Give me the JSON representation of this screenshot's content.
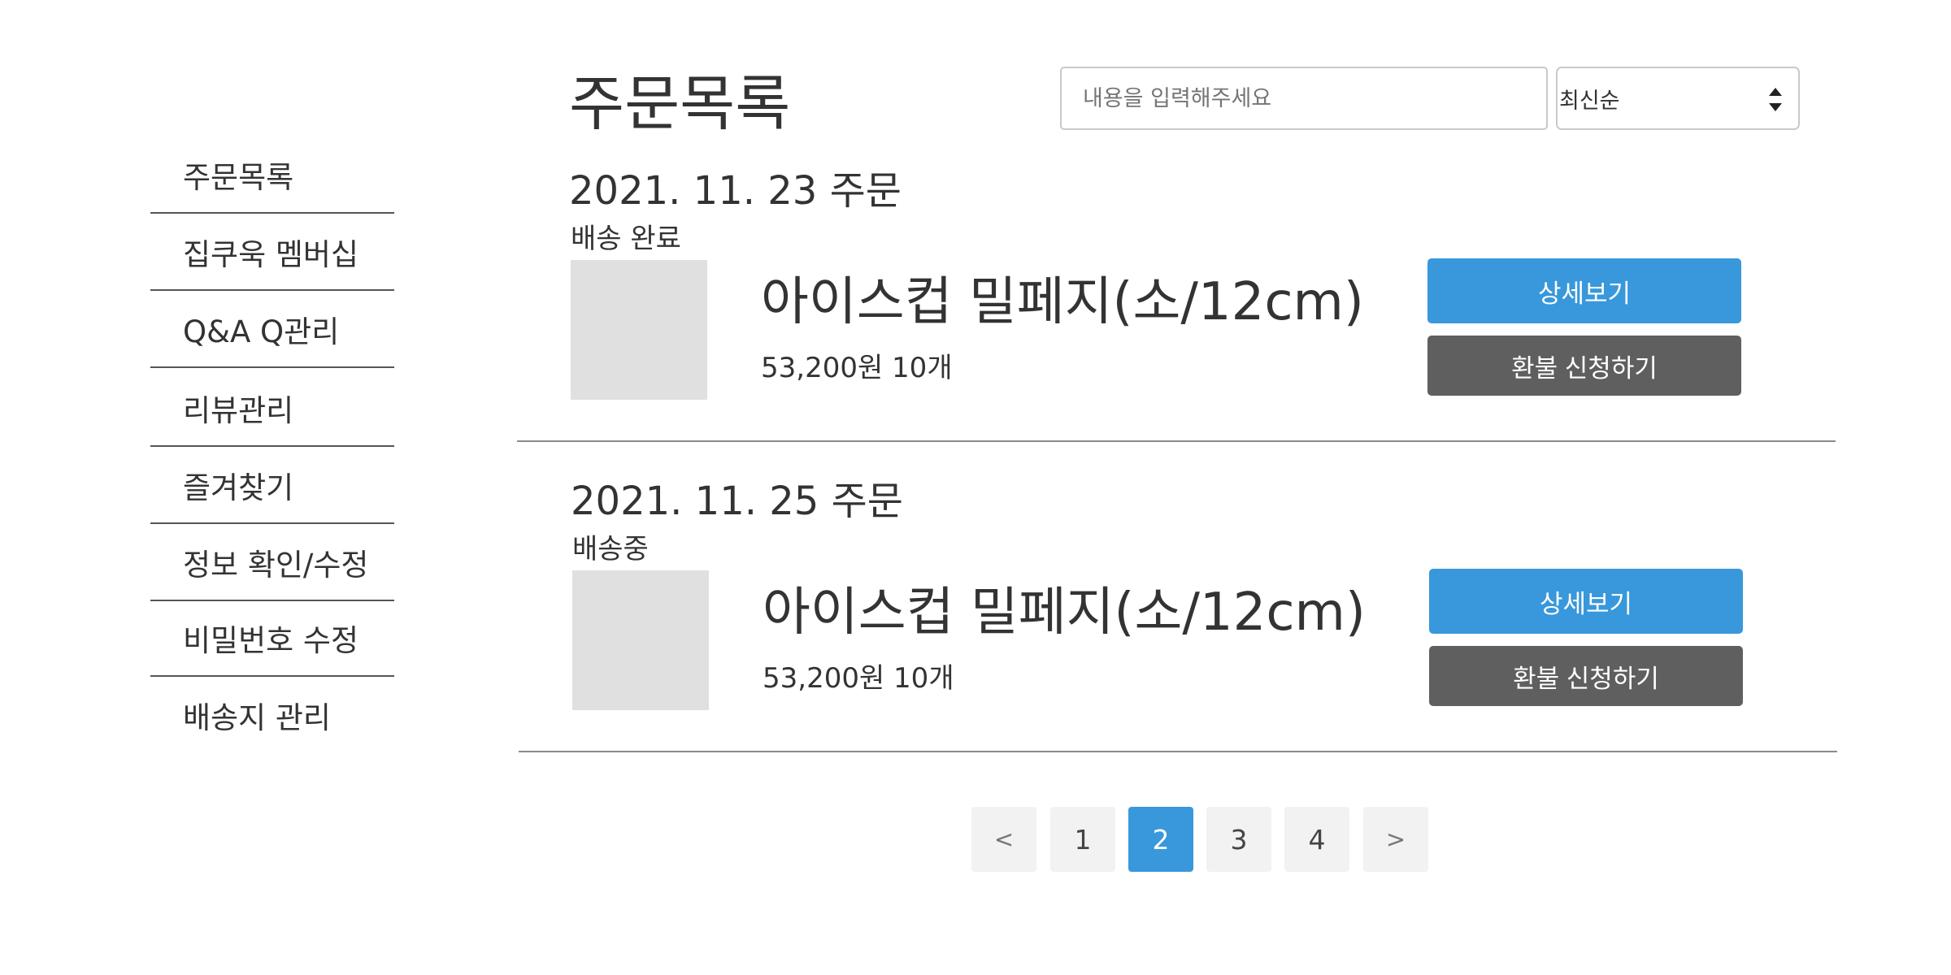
{
  "sidebar": {
    "items": [
      {
        "label": "주문목록"
      },
      {
        "label": "집쿠욱 멤버십"
      },
      {
        "label": "Q&A Q관리"
      },
      {
        "label": "리뷰관리"
      },
      {
        "label": "즐겨찾기"
      },
      {
        "label": "정보 확인/수정"
      },
      {
        "label": "비밀번호 수정"
      },
      {
        "label": "배송지 관리"
      }
    ]
  },
  "header": {
    "title": "주문목록",
    "search_placeholder": "내용을 입력해주세요",
    "sort_value": "최신순"
  },
  "orders": [
    {
      "date": "2021. 11. 23 주문",
      "status": "배송 완료",
      "product_name": "아이스컵 밀페지(소/12cm)",
      "price_qty": "53,200원 10개",
      "detail_label": "상세보기",
      "refund_label": "환불 신청하기"
    },
    {
      "date": "2021. 11. 25 주문",
      "status": "배송중",
      "product_name": "아이스컵 밀페지(소/12cm)",
      "price_qty": "53,200원 10개",
      "detail_label": "상세보기",
      "refund_label": "환불 신청하기"
    }
  ],
  "pagination": {
    "prev": "<",
    "pages": [
      "1",
      "2",
      "3",
      "4"
    ],
    "current": "2",
    "next": ">"
  },
  "colors": {
    "accent": "#3898db",
    "refund_button": "#5f5f5f",
    "thumbnail": "#e0e0e0",
    "pagination_bg": "#f2f2f2"
  }
}
